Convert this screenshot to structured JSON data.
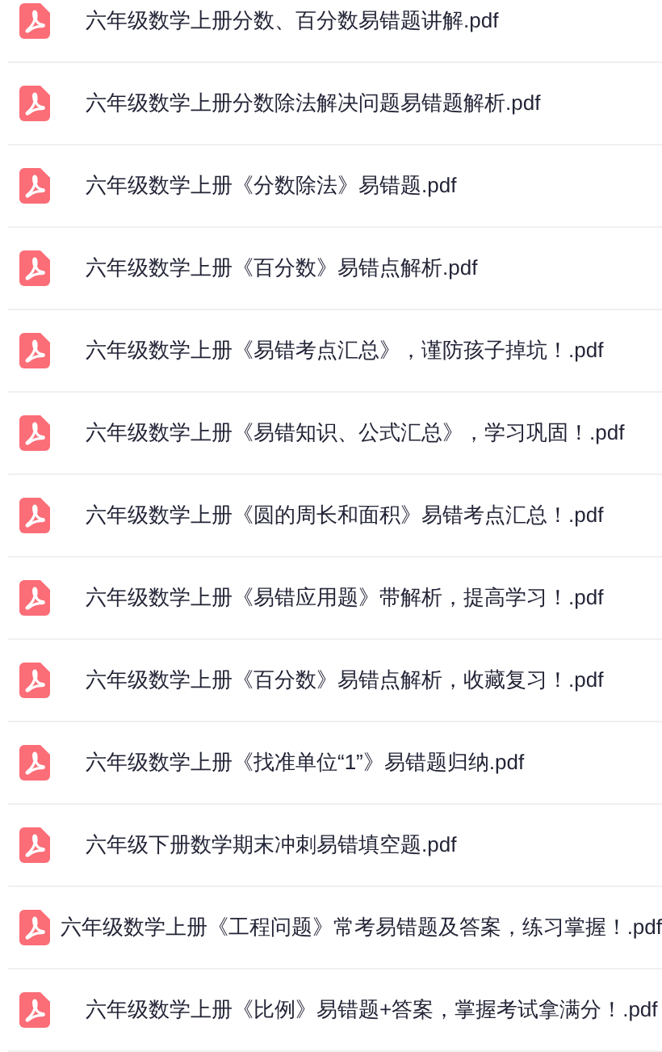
{
  "files": [
    {
      "name": "六年级数学上册分数、百分数易错题讲解.pdf"
    },
    {
      "name": "六年级数学上册分数除法解决问题易错题解析.pdf"
    },
    {
      "name": "六年级数学上册《分数除法》易错题.pdf"
    },
    {
      "name": "六年级数学上册《百分数》易错点解析.pdf"
    },
    {
      "name": "六年级数学上册《易错考点汇总》，谨防孩子掉坑！.pdf"
    },
    {
      "name": "六年级数学上册《易错知识、公式汇总》，学习巩固！.pdf"
    },
    {
      "name": "六年级数学上册《圆的周长和面积》易错考点汇总！.pdf"
    },
    {
      "name": "六年级数学上册《易错应用题》带解析，提高学习！.pdf"
    },
    {
      "name": "六年级数学上册《百分数》易错点解析，收藏复习！.pdf"
    },
    {
      "name": "六年级数学上册《找准单位“1”》易错题归纳.pdf"
    },
    {
      "name": "六年级下册数学期末冲刺易错填空题.pdf"
    },
    {
      "name": "六年级数学上册《工程问题》常考易错题及答案，练习掌握！.pdf"
    },
    {
      "name": "六年级数学上册《比例》易错题+答案，掌握考试拿满分！.pdf"
    }
  ]
}
